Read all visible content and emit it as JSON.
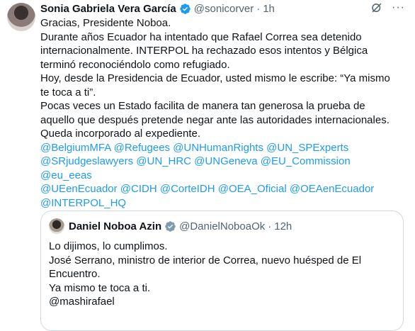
{
  "tweet": {
    "author_name": "Sonia Gabriela Vera García",
    "handle": "@sonicorver",
    "separator": "·",
    "time": "1h",
    "more": "···",
    "lines": [
      "Gracias, Presidente Noboa.",
      "Durante años Ecuador ha intentado que Rafael Correa sea detenido",
      "internacionalmente. INTERPOL ha rechazado esos intentos y Bélgica",
      "terminó reconociéndolo como refugiado.",
      "Hoy, desde la Presidencia de Ecuador, usted mismo le escribe: “Ya mismo",
      "te toca a ti”.",
      "Pocas veces un Estado facilita de manera tan generosa la prueba de",
      "aquello que después pretende negar ante las autoridades internacionales.",
      "Queda incorporado al expediente."
    ],
    "mention_lines": [
      "@BelgiumMFA @Refugees @UNHumanRights @UN_SPExperts",
      "@SRjudgeslawyers @UN_HRC @UNGeneva @EU_Commission @eu_eeas",
      "@UEenEcuador @CIDH @CorteIDH @OEA_Oficial @OEAenEcuador",
      "@INTERPOL_HQ"
    ]
  },
  "quoted": {
    "author_name": "Daniel Noboa Azin",
    "handle": "@DanielNoboaOk",
    "separator": "·",
    "time": "12h",
    "lines": [
      "Lo dijimos, lo cumplimos.",
      "José Serrano, ministro de interior de Correa, nuevo huésped de El",
      "Encuentro.",
      "Ya mismo te toca a ti.",
      "@mashirafael"
    ]
  },
  "colors": {
    "text": "#0f1419",
    "secondary": "#536471",
    "link": "#1d9bf0",
    "border": "#cfd9de"
  }
}
